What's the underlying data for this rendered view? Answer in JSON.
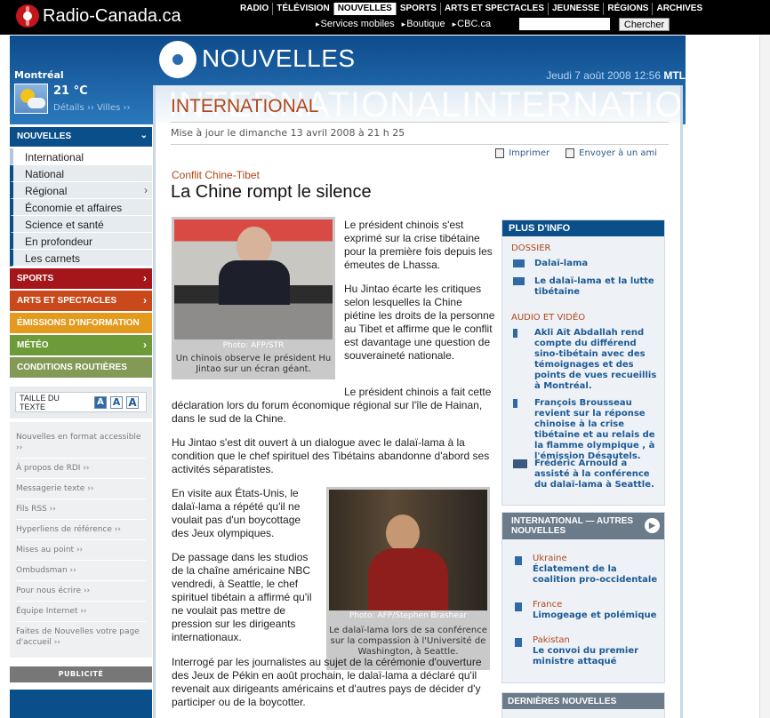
{
  "brand": {
    "name": "Radio-Canada.ca"
  },
  "nav": {
    "main": [
      "RADIO",
      "TÉLÉVISION",
      "NOUVELLES",
      "SPORTS",
      "ARTS ET SPECTACLES",
      "JEUNESSE",
      "RÉGIONS",
      "ARCHIVES"
    ],
    "active": "NOUVELLES",
    "sub": [
      "Services mobiles",
      "Boutique",
      "CBC.ca"
    ],
    "search_button": "Chercher",
    "search_value": ""
  },
  "banner": {
    "section": "NOUVELLES",
    "date": "Jeudi 7 août 2008 12:56",
    "tz": "MTL"
  },
  "weather": {
    "city": "Montréal",
    "temp": "21 °C",
    "links": "Détails ›› Villes ››"
  },
  "sidebar": {
    "nouvelles_head": "NOUVELLES",
    "items": [
      "International",
      "National",
      "Régional",
      "Économie et affaires",
      "Science et santé",
      "En profondeur",
      "Les carnets"
    ],
    "categories": [
      {
        "label": "SPORTS",
        "color": "#a5161b"
      },
      {
        "label": "ARTS ET SPECTACLES",
        "color": "#c9491b"
      },
      {
        "label": "ÉMISSIONS D'INFORMATION",
        "color": "#e39a1d"
      },
      {
        "label": "MÉTÉO",
        "color": "#6e9b3a"
      },
      {
        "label": "CONDITIONS ROUTIÈRES",
        "color": "#829a55"
      }
    ],
    "text_size_label": "TAILLE DU TEXTE",
    "text_size_options": [
      "A",
      "A",
      "A"
    ],
    "utility_links": [
      "Nouvelles en format accessible",
      "À propos de RDI",
      "Messagerie texte",
      "Fils RSS",
      "Hyperliens de référence",
      "Mises au point",
      "Ombudsman",
      "Pour nous écrire",
      "Équipe Internet",
      "Faites de Nouvelles votre page d'accueil"
    ],
    "ad_label": "PUBLICITÉ"
  },
  "article": {
    "ghost": "INTERNATIONALINTERNATIONA",
    "section_title": "INTERNATIONAL",
    "updated": "Mise à jour le dimanche 13 avril 2008 à 21 h 25",
    "print": "Imprimer",
    "send": "Envoyer à un ami",
    "kicker": "Conflit Chine-Tibet",
    "headline": "La Chine rompt le silence",
    "photo1": {
      "credit": "Photo: AFP/STR",
      "caption": "Un chinois observe le président Hu Jintao sur un écran géant."
    },
    "photo2": {
      "credit": "Photo: AFP/Stephen Brashear",
      "caption": "Le dalaï-lama lors de sa conférence sur la compassion à l'Université de Washington, à Seattle."
    },
    "paragraphs": [
      "Le président chinois s'est exprimé sur la crise tibétaine pour la première fois depuis les émeutes de Lhassa.",
      "Hu Jintao écarte les critiques selon lesquelles la Chine piétine les droits de la personne au Tibet et affirme que le conflit est davantage une question de souveraineté nationale.",
      "Le président chinois a fait cette déclaration lors du forum économique régional sur l'île de Hainan, dans le sud de la Chine.",
      "Hu Jintao s'est dit ouvert à un dialogue avec le dalaï-lama à la condition que le chef spirituel des Tibétains abandonne d'abord ses activités séparatistes.",
      "En visite aux États-Unis, le dalaï-lama a répété qu'il ne voulait pas d'un boycottage des Jeux olympiques.",
      "De passage dans les studios de la chaîne américaine NBC vendredi, à Seattle, le chef spirituel tibétain a affirmé qu'il ne voulait pas mettre de pression sur les dirigeants internationaux.",
      "Interrogé par les journalistes au sujet de la cérémonie d'ouverture des Jeux de Pékin en août prochain, le dalaï-lama a déclaré qu'il revenait aux dirigeants américains et d'autres pays de décider d'y participer ou de la boycotter."
    ]
  },
  "plus_info": {
    "title": "PLUS D'INFO",
    "dossier_label": "DOSSIER",
    "dossier": [
      "Dalaï-lama",
      "Le dalaï-lama et la lutte tibétaine"
    ],
    "av_label": "AUDIO ET VIDÉO",
    "av": [
      "Akli Aït Abdallah rend compte du différend sino-tibétain avec des témoignages et des points de vues recueillis à Montréal.",
      "François Brousseau revient sur la réponse chinoise à la crise tibétaine et au relais de la flamme olympique , à l'émission Désautels.",
      "Frédéric Arnould a assisté à la conférence du dalaï-lama à Seattle."
    ]
  },
  "international_box": {
    "title": "INTERNATIONAL — AUTRES NOUVELLES",
    "items": [
      {
        "country": "Ukraine",
        "title": "Éclatement de la coalition pro-occidentale"
      },
      {
        "country": "France",
        "title": "Limogeage et polémique"
      },
      {
        "country": "Pakistan",
        "title": "Le convoi du premier ministre attaqué"
      }
    ]
  },
  "dernieres": {
    "title": "DERNIÈRES NOUVELLES"
  }
}
